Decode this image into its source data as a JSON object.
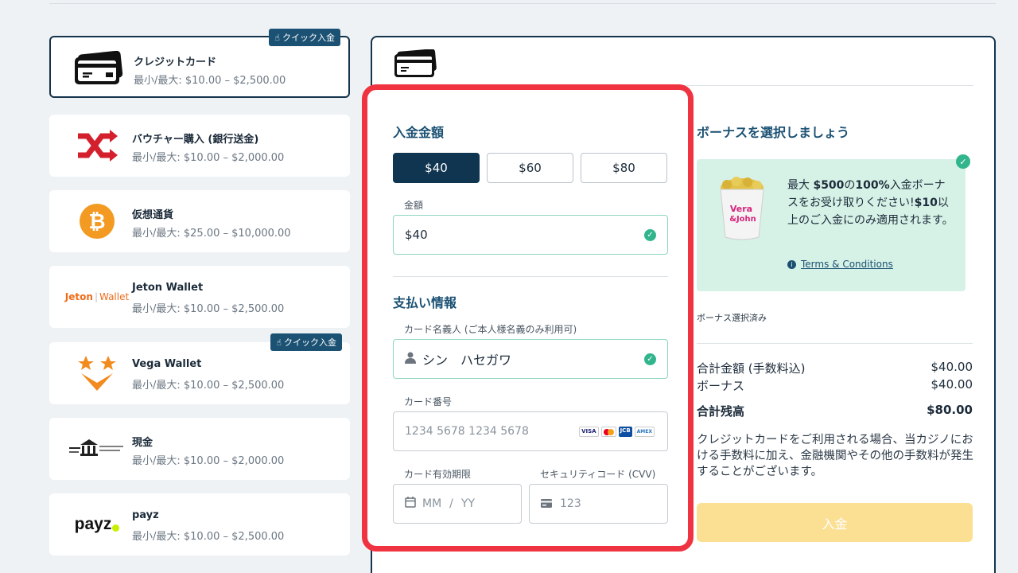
{
  "methods": [
    {
      "name": "クレジットカード",
      "limit": "最小/最大: $10.00 – $2,500.00",
      "quick": "クイック入金",
      "icon": "credit-card-icon"
    },
    {
      "name": "バウチャー購入 (銀行送金)",
      "limit": "最小/最大: $10.00 – $2,000.00",
      "icon": "shuffle-icon"
    },
    {
      "name": "仮想通貨",
      "limit": "最小/最大: $25.00 – $10,000.00",
      "icon": "bitcoin-icon"
    },
    {
      "name": "Jeton Wallet",
      "limit": "最小/最大: $10.00 – $2,500.00",
      "logo_text": "Jeton",
      "logo_text2": "Wallet"
    },
    {
      "name": "Vega Wallet",
      "limit": "最小/最大: $10.00 – $2,500.00",
      "quick": "クイック入金",
      "icon": "vega-wallet-icon"
    },
    {
      "name": "現金",
      "limit": "最小/最大: $10.00 – $2,000.00",
      "icon": "bank-icon"
    },
    {
      "name": "payz",
      "limit": "最小/最大: $10.00 – $2,500.00",
      "logo_text": "payz"
    }
  ],
  "deposit": {
    "title": "入金金額",
    "presets": [
      "$40",
      "$60",
      "$80"
    ],
    "selected_preset": "$40",
    "amount_label": "金額",
    "amount_value": "$40"
  },
  "payment": {
    "title": "支払い情報",
    "holder_label": "カード名義人 (ご本人様名義のみ利用可)",
    "holder_value": "シン　ハセガワ",
    "number_label": "カード番号",
    "number_placeholder": "1234 5678 1234 5678",
    "expiry_label": "カード有効期限",
    "expiry_mm": "MM",
    "expiry_sep": "/",
    "expiry_yy": "YY",
    "cvv_label": "セキュリティコード (CVV)",
    "cvv_placeholder": "123",
    "card_brands": [
      "VISA",
      "MC",
      "JCB",
      "AMEX"
    ]
  },
  "bonus": {
    "title": "ボーナスを選択しましょう",
    "text_1": "最大 ",
    "text_amount": "$500",
    "text_2": "の",
    "text_pct": "100%",
    "text_3": "入金ボーナスをお受け取りください!",
    "text_min": "$10",
    "text_4": "以上のご入金にのみ適用されます。",
    "terms": "Terms & Conditions",
    "selected_text": "ボーナス選択済み",
    "brand_line1": "Vera",
    "brand_line2": "&John"
  },
  "summary": {
    "rows": [
      {
        "label": "合計金額 (手数料込)",
        "value": "$40.00"
      },
      {
        "label": "ボーナス",
        "value": "$40.00"
      },
      {
        "label": "合計残高",
        "value": "$80.00"
      }
    ],
    "note": "クレジットカードをご利用される場合、当カジノにおける手数料に加え、金融機関やその他の手数料が発生することがございます。",
    "button": "入金"
  },
  "colors": {
    "accent": "#0f3550",
    "highlight": "#ef3340",
    "success": "#32b58c",
    "button_disabled": "#fbdf93"
  }
}
